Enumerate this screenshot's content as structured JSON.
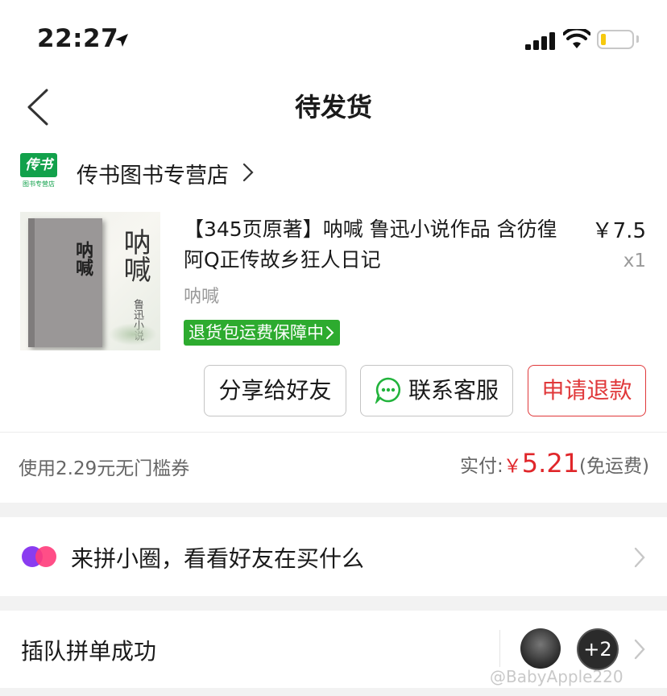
{
  "status_bar": {
    "time": "22:27",
    "battery_color": "#f6c90e"
  },
  "nav": {
    "title": "待发货"
  },
  "shop": {
    "logo_text": "传书",
    "logo_subtext": "图书专营店",
    "name": "传书图书专营店",
    "brand_color": "#12a14b"
  },
  "product": {
    "cover_title": "呐喊",
    "cover_subtitle": "鲁迅小说",
    "title": "【345页原著】呐喊 鲁迅小说作品 含彷徨 阿Q正传故乡狂人日记",
    "price": "￥7.5",
    "quantity": "x1",
    "spec": "呐喊",
    "guarantee": "退货包运费保障中",
    "guarantee_color": "#2dab2f"
  },
  "actions": {
    "share_label": "分享给好友",
    "service_label": "联系客服",
    "refund_label": "申请退款",
    "accent_color": "#e0383a"
  },
  "summary": {
    "coupon_text": "使用2.29元无门槛券",
    "paid_label": "实付:",
    "currency": "￥",
    "paid_amount": "5.21",
    "shipping_note": "(免运费)"
  },
  "circle": {
    "text": "来拼小圈，看看好友在买什么"
  },
  "group": {
    "text": "插队拼单成功",
    "more_count": "+2"
  },
  "watermark": "@BabyApple220"
}
